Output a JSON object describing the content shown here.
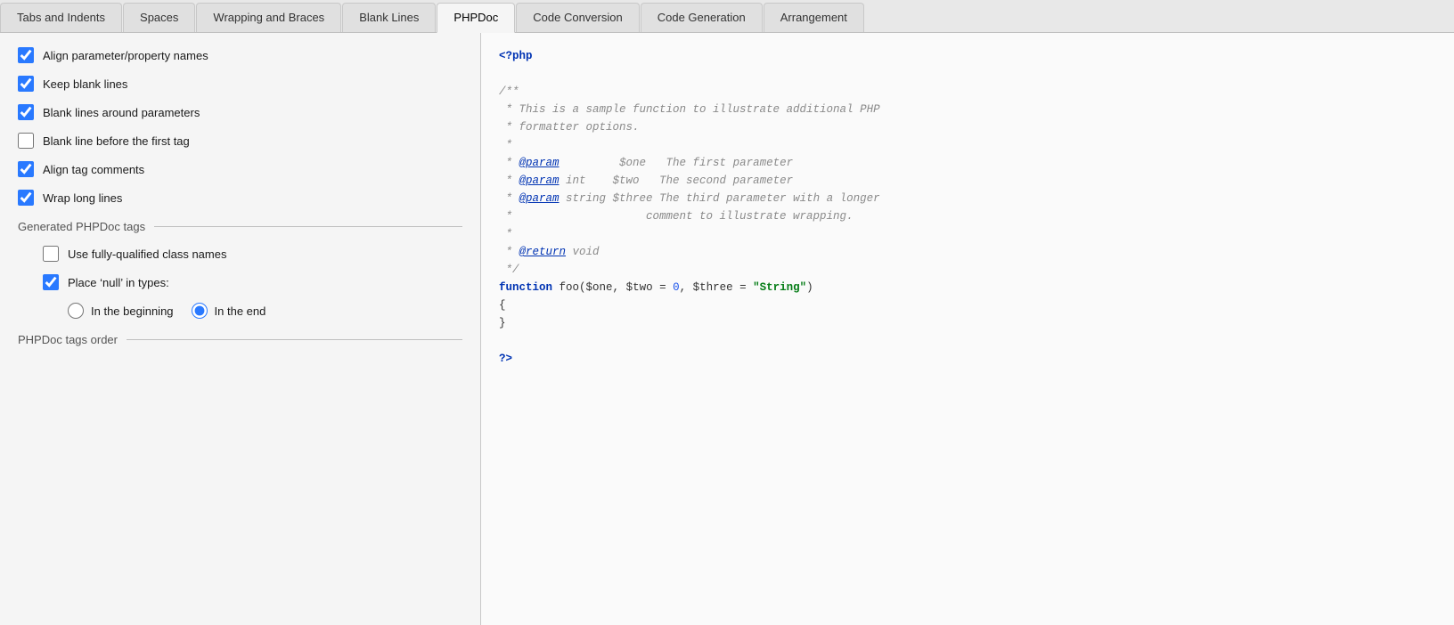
{
  "tabs": [
    {
      "id": "tabs-indents",
      "label": "Tabs and Indents",
      "active": false
    },
    {
      "id": "spaces",
      "label": "Spaces",
      "active": false
    },
    {
      "id": "wrapping-braces",
      "label": "Wrapping and Braces",
      "active": false
    },
    {
      "id": "blank-lines",
      "label": "Blank Lines",
      "active": false
    },
    {
      "id": "phpdoc",
      "label": "PHPDoc",
      "active": true
    },
    {
      "id": "code-conversion",
      "label": "Code Conversion",
      "active": false
    },
    {
      "id": "code-generation",
      "label": "Code Generation",
      "active": false
    },
    {
      "id": "arrangement",
      "label": "Arrangement",
      "active": false
    }
  ],
  "checkboxes": [
    {
      "id": "align-param",
      "label": "Align parameter/property names",
      "checked": true
    },
    {
      "id": "keep-blank",
      "label": "Keep blank lines",
      "checked": true
    },
    {
      "id": "blank-around-params",
      "label": "Blank lines around parameters",
      "checked": true
    },
    {
      "id": "blank-before-first",
      "label": "Blank line before the first tag",
      "checked": false
    },
    {
      "id": "align-tag-comments",
      "label": "Align tag comments",
      "checked": true
    },
    {
      "id": "wrap-long-lines",
      "label": "Wrap long lines",
      "checked": true
    }
  ],
  "generated_section": {
    "label": "Generated PHPDoc tags",
    "sub_checkboxes": [
      {
        "id": "fully-qualified",
        "label": "Use fully-qualified class names",
        "checked": false
      },
      {
        "id": "place-null",
        "label": "Place ‘null’ in types:",
        "checked": true
      }
    ],
    "radio_group": {
      "name": "null-position",
      "options": [
        {
          "id": "beginning",
          "label": "In the beginning",
          "selected": false
        },
        {
          "id": "end",
          "label": "In the end",
          "selected": true
        }
      ]
    }
  },
  "tags_order_section": {
    "label": "PHPDoc tags order"
  },
  "code_preview": {
    "lines": [
      {
        "type": "php-tag",
        "content": "<?php"
      },
      {
        "type": "blank",
        "content": ""
      },
      {
        "type": "comment",
        "content": "/**"
      },
      {
        "type": "comment",
        "content": " * This is a sample function to illustrate additional PHP"
      },
      {
        "type": "comment",
        "content": " * formatter options."
      },
      {
        "type": "comment",
        "content": " *"
      },
      {
        "type": "comment-param",
        "content": " * @param $one  The first parameter"
      },
      {
        "type": "comment-param",
        "content": " * @param int  $two  The second parameter"
      },
      {
        "type": "comment-param",
        "content": " * @param string $three The third parameter with a longer"
      },
      {
        "type": "comment",
        "content": " *                    comment to illustrate wrapping."
      },
      {
        "type": "comment",
        "content": " *"
      },
      {
        "type": "comment-return",
        "content": " * @return void"
      },
      {
        "type": "comment",
        "content": " */"
      },
      {
        "type": "function",
        "content": "function foo($one, $two = 0, $three = \"String\")"
      },
      {
        "type": "brace",
        "content": "{"
      },
      {
        "type": "brace",
        "content": "}"
      },
      {
        "type": "blank",
        "content": ""
      },
      {
        "type": "php-tag",
        "content": "?>"
      }
    ]
  }
}
